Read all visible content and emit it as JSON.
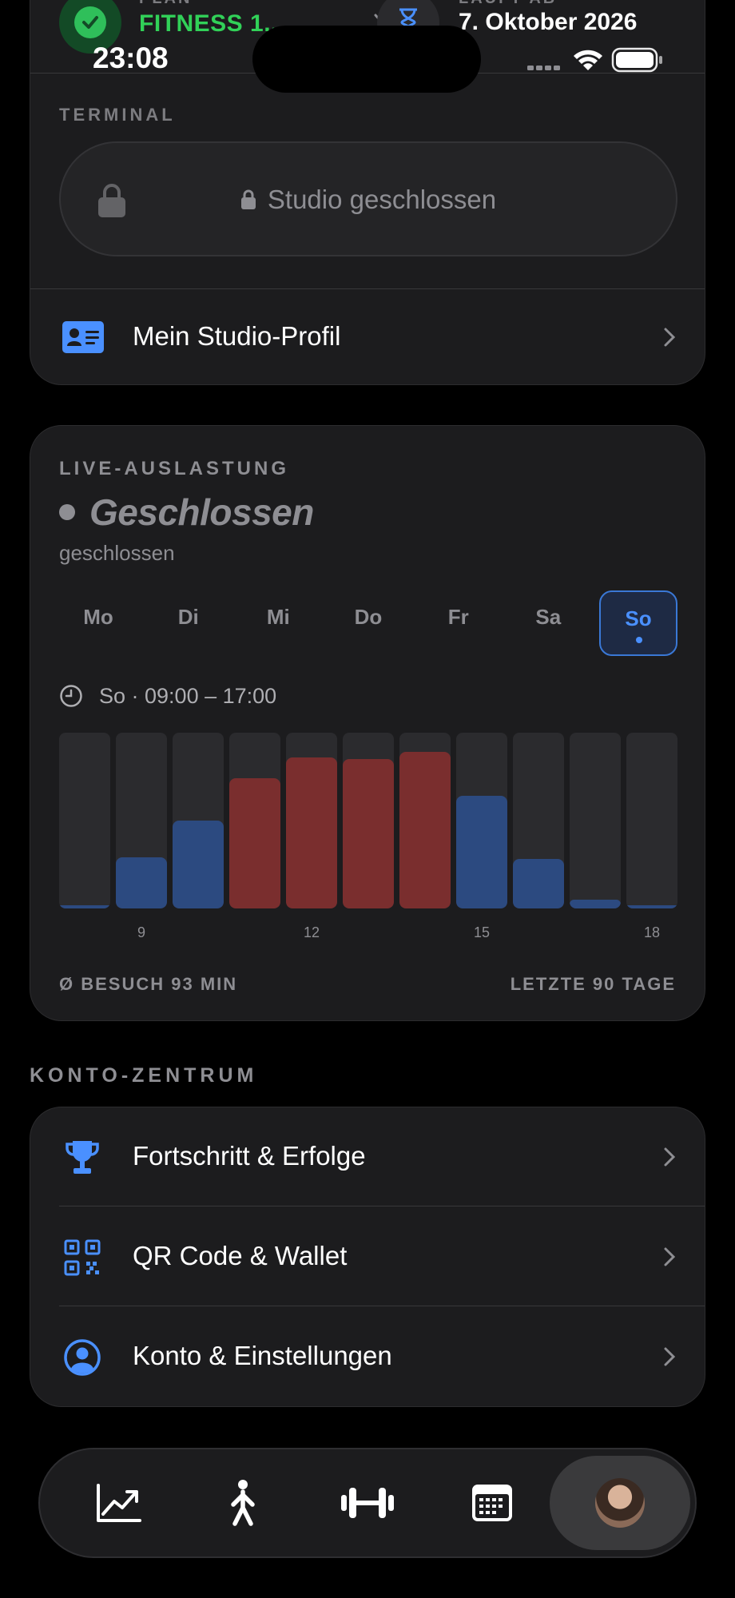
{
  "status_bar": {
    "time": "23:08"
  },
  "membership": {
    "plan_label": "PLAN",
    "plan_name": "FITNESS 1...",
    "expiry_label": "LÄUFT AB",
    "expiry_date": "7. Oktober 2026"
  },
  "terminal": {
    "label": "TERMINAL",
    "button_text": "Studio geschlossen"
  },
  "studio_profile": {
    "label": "Mein Studio-Profil"
  },
  "live": {
    "label": "LIVE-AUSLASTUNG",
    "status": "Geschlossen",
    "status_sub": "geschlossen",
    "days": [
      "Mo",
      "Di",
      "Mi",
      "Do",
      "Fr",
      "Sa",
      "So"
    ],
    "selected_day": "So",
    "hours": "So · 09:00 – 17:00",
    "footer_left": "Ø BESUCH 93 MIN",
    "footer_right": "LETZTE 90 TAGE"
  },
  "chart_data": {
    "type": "bar",
    "categories": [
      "8",
      "9",
      "10",
      "11",
      "12",
      "13",
      "14",
      "15",
      "16",
      "17",
      "18"
    ],
    "x_tick_labels": {
      "9": "9",
      "12": "12",
      "15": "15",
      "18": "18"
    },
    "values": [
      0.02,
      0.29,
      0.5,
      0.74,
      0.86,
      0.85,
      0.89,
      0.64,
      0.28,
      0.05,
      0.02
    ],
    "high_threshold": 0.7,
    "ylim": [
      0,
      1
    ],
    "colors": {
      "normal": "#2c4a80",
      "high": "#7a2e2e",
      "track": "#2b2b2e"
    }
  },
  "konto": {
    "title": "KONTO-ZENTRUM",
    "items": [
      {
        "label": "Fortschritt & Erfolge",
        "icon": "trophy-icon"
      },
      {
        "label": "QR Code & Wallet",
        "icon": "qr-code-icon"
      },
      {
        "label": "Konto & Einstellungen",
        "icon": "person-circle-icon"
      }
    ]
  },
  "tabbar": {
    "items": [
      "chart-trend-icon",
      "walking-person-icon",
      "dumbbell-icon",
      "calendar-icon",
      "avatar"
    ],
    "active": "avatar"
  },
  "colors": {
    "accent": "#4a90ff",
    "plan_green": "#31d158",
    "card_bg": "#1c1c1e"
  }
}
